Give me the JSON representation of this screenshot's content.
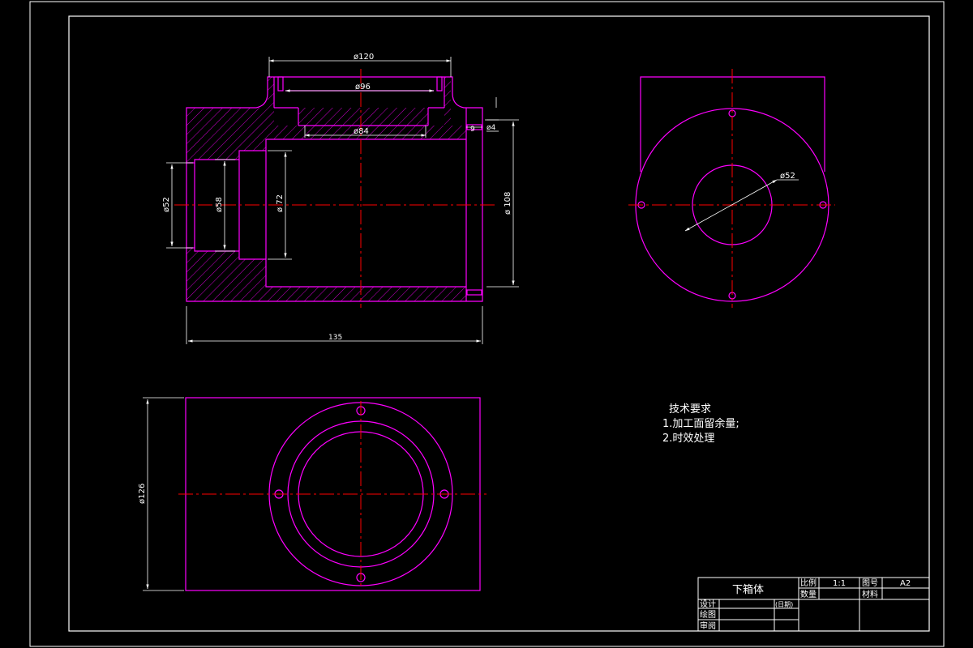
{
  "colors": {
    "background": "#000000",
    "frame": "#ffffff",
    "geometry": "#ff00ff",
    "centerline": "#ff0000",
    "dimension": "#ffffff"
  },
  "dimensions": {
    "d120": "ø120",
    "d96": "ø96",
    "d84": "ø84",
    "d4": "ø4",
    "w9": "9",
    "d108": "ø 108",
    "d72": "ø 72",
    "d58": "ø58",
    "d52_section": "ø52",
    "length": "135",
    "d52_side": "ø52",
    "d126": "ø126"
  },
  "notes": {
    "title": "技术要求",
    "item1": "1.加工面留余量;",
    "item2": "2.时效处理"
  },
  "title_block": {
    "part_name": "下箱体",
    "scale_label": "比例",
    "scale_value": "1:1",
    "drawing_no_label": "图号",
    "drawing_no_value": "A2",
    "quantity_label": "数量",
    "material_label": "材料",
    "designer_label": "设计",
    "date_label": "(日期)",
    "drafter_label": "绘图",
    "reviewer_label": "审阅"
  }
}
